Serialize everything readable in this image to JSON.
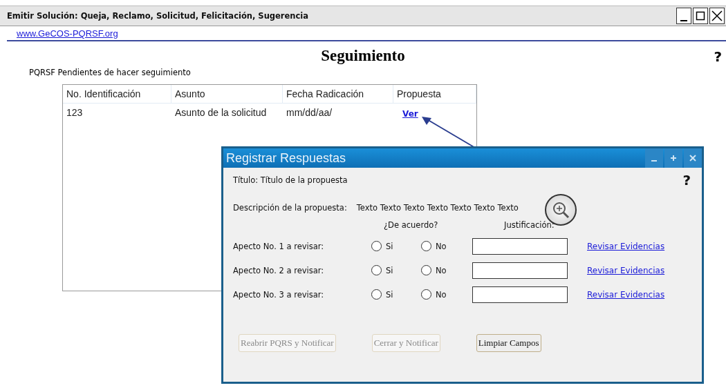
{
  "window": {
    "title": "Emitir Solución: Queja, Reclamo, Solicitud, Felicitación, Sugerencia"
  },
  "site_link": "www.GeCOS-PQRSF.org",
  "page_title": "Seguimiento",
  "help": "?",
  "subtitle": "PQRSF Pendientes de hacer seguimiento",
  "table": {
    "columns": [
      "No. Identificación",
      "Asunto",
      "Fecha Radicación",
      "Propuesta"
    ],
    "rows": [
      {
        "id": "123",
        "asunto": "Asunto de la solicitud",
        "fecha": "mm/dd/aa/",
        "link": "Ver"
      }
    ]
  },
  "dialog": {
    "title": "Registrar Respuestas",
    "help": "?",
    "titulo": "Título: Título de la propuesta",
    "descripcion_label": "Descripción de la propuesta:",
    "descripcion": "Texto Texto Texto Texto Texto Texto Texto",
    "agree_header": "¿De acuerdo?",
    "justification_header": "Justificación:",
    "aspects": [
      {
        "label": "Apecto No. 1  a revisar:",
        "options": [
          {
            "label": "Si",
            "selected": false
          },
          {
            "label": "No",
            "selected": false
          }
        ],
        "link": "Revisar Evidencias"
      },
      {
        "label": "Apecto No. 2  a revisar:",
        "options": [
          {
            "label": "Si",
            "selected": false
          },
          {
            "label": "No",
            "selected": false
          }
        ],
        "link": "Revisar Evidencias"
      },
      {
        "label": "Apecto No. 3  a revisar:",
        "options": [
          {
            "label": "Si",
            "selected": false
          },
          {
            "label": "No",
            "selected": false
          }
        ],
        "link": "Revisar Evidencias"
      }
    ],
    "buttons": [
      {
        "label": "Reabrir PQRS y Notificar",
        "disabled": true
      },
      {
        "label": "Cerrar y Notificar",
        "disabled": true
      },
      {
        "label": "Limpiar Campos",
        "disabled": false
      }
    ]
  }
}
